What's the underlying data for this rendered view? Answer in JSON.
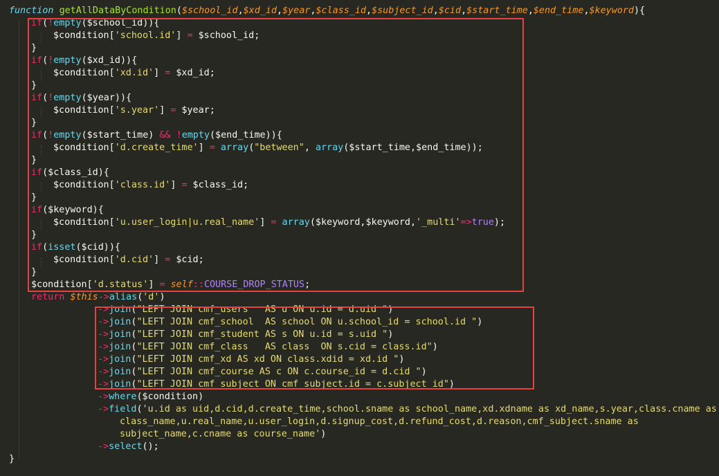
{
  "code_lines": [
    [
      [
        "kw",
        "function"
      ],
      [
        "tx",
        " "
      ],
      [
        "fn",
        "getAllDataByCondition"
      ],
      [
        "tx",
        "("
      ],
      [
        "pm",
        "$school_id"
      ],
      [
        "tx",
        ","
      ],
      [
        "pm",
        "$xd_id"
      ],
      [
        "tx",
        ","
      ],
      [
        "pm",
        "$year"
      ],
      [
        "tx",
        ","
      ],
      [
        "pm",
        "$class_id"
      ],
      [
        "tx",
        ","
      ],
      [
        "pm",
        "$subject_id"
      ],
      [
        "tx",
        ","
      ],
      [
        "pm",
        "$cid"
      ],
      [
        "tx",
        ","
      ],
      [
        "pm",
        "$start_time"
      ],
      [
        "tx",
        ","
      ],
      [
        "pm",
        "$end_time"
      ],
      [
        "tx",
        ","
      ],
      [
        "pm",
        "$keyword"
      ],
      [
        "tx",
        "){"
      ]
    ],
    [
      [
        "op",
        "if"
      ],
      [
        "tx",
        "("
      ],
      [
        "op",
        "!"
      ],
      [
        "bf",
        "empty"
      ],
      [
        "tx",
        "($school_id)){"
      ]
    ],
    [
      [
        "tx",
        "$condition["
      ],
      [
        "st",
        "'school.id'"
      ],
      [
        "tx",
        "] "
      ],
      [
        "op",
        "="
      ],
      [
        "tx",
        " $school_id;"
      ]
    ],
    [
      [
        "tx",
        "}"
      ]
    ],
    [
      [
        "op",
        "if"
      ],
      [
        "tx",
        "("
      ],
      [
        "op",
        "!"
      ],
      [
        "bf",
        "empty"
      ],
      [
        "tx",
        "($xd_id)){"
      ]
    ],
    [
      [
        "tx",
        "$condition["
      ],
      [
        "st",
        "'xd.id'"
      ],
      [
        "tx",
        "] "
      ],
      [
        "op",
        "="
      ],
      [
        "tx",
        " $xd_id;"
      ]
    ],
    [
      [
        "tx",
        "}"
      ]
    ],
    [
      [
        "op",
        "if"
      ],
      [
        "tx",
        "("
      ],
      [
        "op",
        "!"
      ],
      [
        "bf",
        "empty"
      ],
      [
        "tx",
        "($year)){"
      ]
    ],
    [
      [
        "tx",
        "$condition["
      ],
      [
        "st",
        "'s.year'"
      ],
      [
        "tx",
        "] "
      ],
      [
        "op",
        "="
      ],
      [
        "tx",
        " $year;"
      ]
    ],
    [
      [
        "tx",
        "}"
      ]
    ],
    [
      [
        "op",
        "if"
      ],
      [
        "tx",
        "("
      ],
      [
        "op",
        "!"
      ],
      [
        "bf",
        "empty"
      ],
      [
        "tx",
        "($start_time) "
      ],
      [
        "op",
        "&&"
      ],
      [
        "tx",
        " "
      ],
      [
        "op",
        "!"
      ],
      [
        "bf",
        "empty"
      ],
      [
        "tx",
        "($end_time)){"
      ]
    ],
    [
      [
        "tx",
        "$condition["
      ],
      [
        "st",
        "'d.create_time'"
      ],
      [
        "tx",
        "] "
      ],
      [
        "op",
        "="
      ],
      [
        "tx",
        " "
      ],
      [
        "bf",
        "array"
      ],
      [
        "tx",
        "("
      ],
      [
        "st",
        "\"between\""
      ],
      [
        "tx",
        ", "
      ],
      [
        "bf",
        "array"
      ],
      [
        "tx",
        "($start_time,$end_time));"
      ]
    ],
    [
      [
        "tx",
        "}"
      ]
    ],
    [
      [
        "op",
        "if"
      ],
      [
        "tx",
        "($class_id){"
      ]
    ],
    [
      [
        "tx",
        "$condition["
      ],
      [
        "st",
        "'class.id'"
      ],
      [
        "tx",
        "] "
      ],
      [
        "op",
        "="
      ],
      [
        "tx",
        " $class_id;"
      ]
    ],
    [
      [
        "tx",
        "}"
      ]
    ],
    [
      [
        "op",
        "if"
      ],
      [
        "tx",
        "($keyword){"
      ]
    ],
    [
      [
        "tx",
        "$condition["
      ],
      [
        "st",
        "'u.user_login|u.real_name'"
      ],
      [
        "tx",
        "] "
      ],
      [
        "op",
        "="
      ],
      [
        "tx",
        " "
      ],
      [
        "bf",
        "array"
      ],
      [
        "tx",
        "($keyword,$keyword,"
      ],
      [
        "st",
        "'_multi'"
      ],
      [
        "op",
        "=>"
      ],
      [
        "cn",
        "true"
      ],
      [
        "tx",
        ");"
      ]
    ],
    [
      [
        "tx",
        "}"
      ]
    ],
    [
      [
        "op",
        "if"
      ],
      [
        "tx",
        "("
      ],
      [
        "bf",
        "isset"
      ],
      [
        "tx",
        "($cid)){"
      ]
    ],
    [
      [
        "tx",
        "$condition["
      ],
      [
        "st",
        "'d.cid'"
      ],
      [
        "tx",
        "] "
      ],
      [
        "op",
        "="
      ],
      [
        "tx",
        " $cid;"
      ]
    ],
    [
      [
        "tx",
        "}"
      ]
    ],
    [
      [
        "tx",
        "$condition["
      ],
      [
        "st",
        "'d.status'"
      ],
      [
        "tx",
        "] "
      ],
      [
        "op",
        "="
      ],
      [
        "tx",
        " "
      ],
      [
        "sf",
        "self"
      ],
      [
        "op",
        "::"
      ],
      [
        "cn",
        "COURSE_DROP_STATUS"
      ],
      [
        "tx",
        ";"
      ]
    ],
    [
      [
        "op",
        "return"
      ],
      [
        "tx",
        " "
      ],
      [
        "sf",
        "$this"
      ],
      [
        "op",
        "->"
      ],
      [
        "bf",
        "alias"
      ],
      [
        "tx",
        "("
      ],
      [
        "st",
        "'d'"
      ],
      [
        "tx",
        ")"
      ]
    ],
    [
      [
        "op",
        "->"
      ],
      [
        "bf",
        "join"
      ],
      [
        "tx",
        "("
      ],
      [
        "st",
        "\"LEFT JOIN cmf_users   AS u ON u.id = d.uid \""
      ],
      [
        "tx",
        ")"
      ]
    ],
    [
      [
        "op",
        "->"
      ],
      [
        "bf",
        "join"
      ],
      [
        "tx",
        "("
      ],
      [
        "st",
        "\"LEFT JOIN cmf_school  AS school ON u.school_id = school.id \""
      ],
      [
        "tx",
        ")"
      ]
    ],
    [
      [
        "op",
        "->"
      ],
      [
        "bf",
        "join"
      ],
      [
        "tx",
        "("
      ],
      [
        "st",
        "\"LEFT JOIN cmf_student AS s ON u.id = s.uid \""
      ],
      [
        "tx",
        ")"
      ]
    ],
    [
      [
        "op",
        "->"
      ],
      [
        "bf",
        "join"
      ],
      [
        "tx",
        "("
      ],
      [
        "st",
        "\"LEFT JOIN cmf_class   AS class  ON s.cid = class.id\""
      ],
      [
        "tx",
        ")"
      ]
    ],
    [
      [
        "op",
        "->"
      ],
      [
        "bf",
        "join"
      ],
      [
        "tx",
        "("
      ],
      [
        "st",
        "\"LEFT JOIN cmf_xd AS xd ON class.xdid = xd.id \""
      ],
      [
        "tx",
        ")"
      ]
    ],
    [
      [
        "op",
        "->"
      ],
      [
        "bf",
        "join"
      ],
      [
        "tx",
        "("
      ],
      [
        "st",
        "\"LEFT JOIN cmf_course AS c ON c.course_id = d.cid \""
      ],
      [
        "tx",
        ")"
      ]
    ],
    [
      [
        "op",
        "->"
      ],
      [
        "bf",
        "join"
      ],
      [
        "tx",
        "("
      ],
      [
        "st",
        "\"LEFT JOIN cmf_subject ON cmf_subject.id = c.subject_id\""
      ],
      [
        "tx",
        ")"
      ]
    ],
    [
      [
        "op",
        "->"
      ],
      [
        "bf",
        "where"
      ],
      [
        "tx",
        "($condition)"
      ]
    ],
    [
      [
        "op",
        "->"
      ],
      [
        "bf",
        "field"
      ],
      [
        "tx",
        "("
      ],
      [
        "st",
        "'u.id as uid,d.cid,d.create_time,school.sname as school_name,xd.xdname as xd_name,s.year,class.cname as"
      ]
    ],
    [
      [
        "st",
        "class_name,u.real_name,u.user_login,d.signup_cost,d.refund_cost,d.reason,cmf_subject.sname as"
      ]
    ],
    [
      [
        "st",
        "subject_name,c.cname as course_name'"
      ],
      [
        "tx",
        ")"
      ]
    ],
    [
      [
        "op",
        "->"
      ],
      [
        "bf",
        "select"
      ],
      [
        "tx",
        "();"
      ]
    ],
    [
      [
        "tx",
        "}"
      ]
    ]
  ]
}
